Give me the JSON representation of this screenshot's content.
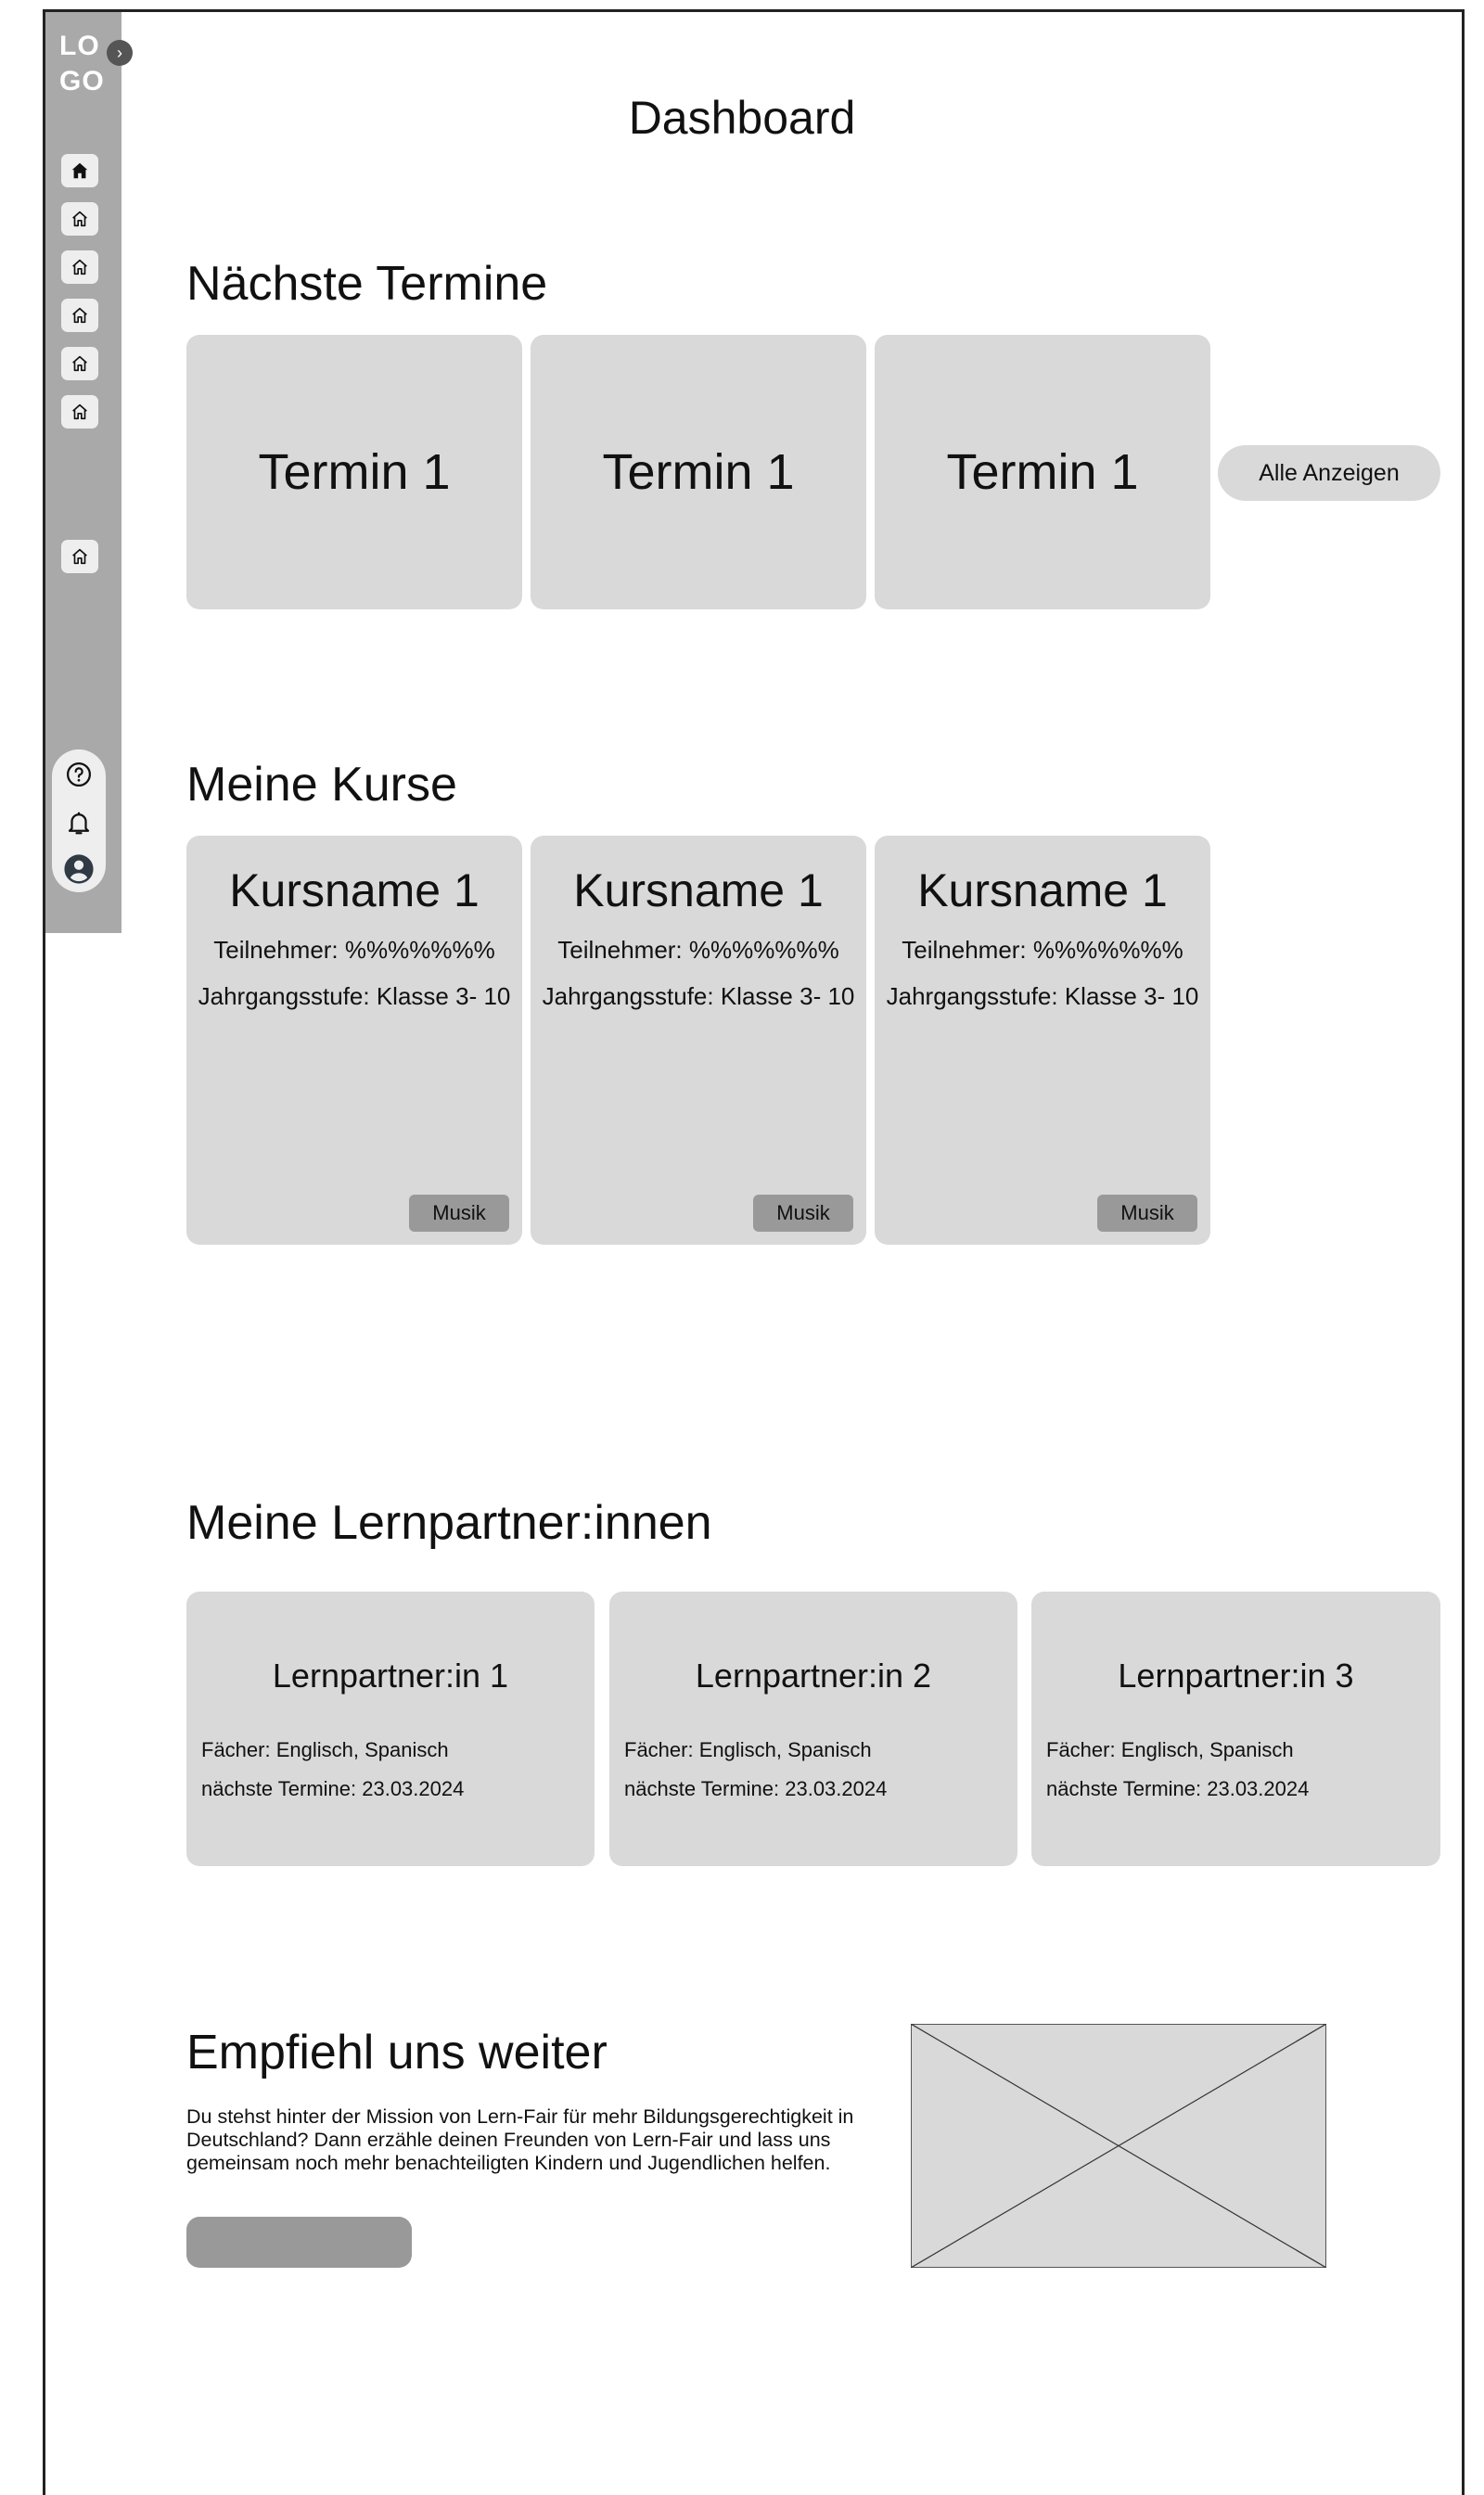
{
  "sidebar": {
    "logo_line1": "LO",
    "logo_line2": "GO",
    "toggle_icon": "chevron-right-icon",
    "nav_icons": [
      "home-filled-icon",
      "home-icon",
      "home-icon",
      "home-icon",
      "home-icon",
      "home-icon",
      "home-icon"
    ],
    "bottom_icons": [
      "help-icon",
      "bell-icon",
      "user-avatar-icon"
    ]
  },
  "header": {
    "title": "Dashboard"
  },
  "appointments": {
    "title": "Nächste Termine",
    "items": [
      {
        "label": "Termin 1"
      },
      {
        "label": "Termin 1"
      },
      {
        "label": "Termin 1"
      }
    ],
    "show_all_label": "Alle Anzeigen"
  },
  "courses": {
    "title": "Meine Kurse",
    "items": [
      {
        "name": "Kursname 1",
        "participants": "Teilnehmer: %%%%%%%",
        "grade": "Jahrgangsstufe: Klasse 3- 10",
        "tag": "Musik"
      },
      {
        "name": "Kursname 1",
        "participants": "Teilnehmer: %%%%%%%",
        "grade": "Jahrgangsstufe: Klasse 3- 10",
        "tag": "Musik"
      },
      {
        "name": "Kursname 1",
        "participants": "Teilnehmer: %%%%%%%",
        "grade": "Jahrgangsstufe: Klasse 3- 10",
        "tag": "Musik"
      }
    ]
  },
  "partners": {
    "title": "Meine Lernpartner:innen",
    "items": [
      {
        "name": "Lernpartner:in 1",
        "subjects": "Fächer: Englisch, Spanisch",
        "next": "nächste Termine: 23.03.2024"
      },
      {
        "name": "Lernpartner:in 2",
        "subjects": "Fächer: Englisch, Spanisch",
        "next": "nächste Termine: 23.03.2024"
      },
      {
        "name": "Lernpartner:in 3",
        "subjects": "Fächer: Englisch, Spanisch",
        "next": "nächste Termine: 23.03.2024"
      }
    ]
  },
  "recommend": {
    "title": "Empfiehl uns weiter",
    "text": "Du stehst hinter der Mission von Lern-Fair für mehr Bildungsgerechtigkeit in Deutschland? Dann erzähle deinen Freunden von Lern-Fair und lass uns gemeinsam noch mehr benachteiligten Kindern und Jugendlichen helfen.",
    "button_label": "",
    "image_icon": "image-placeholder-icon"
  }
}
